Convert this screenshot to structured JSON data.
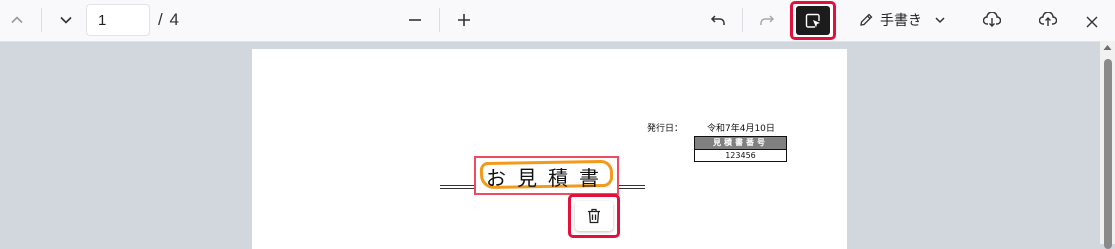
{
  "toolbar": {
    "page_input_value": "1",
    "page_total": "/ 4",
    "draw_label": "手書き",
    "icons": {
      "prev_page": "chevron-up-icon",
      "next_page": "chevron-down-icon",
      "zoom_out": "minus-icon",
      "zoom_in": "plus-icon",
      "undo": "undo-icon",
      "redo": "redo-icon",
      "select": "select-cursor-icon",
      "draw": "pen-icon",
      "download": "download-icon",
      "upload": "upload-icon",
      "close": "close-icon"
    }
  },
  "document": {
    "issue_label": "発行日：",
    "issue_date": "令和7年4月10日",
    "quote_number_header": "見積書番号",
    "quote_number_value": "123456",
    "title": "お見積書"
  },
  "colors": {
    "highlight_red": "#e2103a",
    "selection_pink": "#ef4a62",
    "ink_orange": "#f39a1d"
  }
}
